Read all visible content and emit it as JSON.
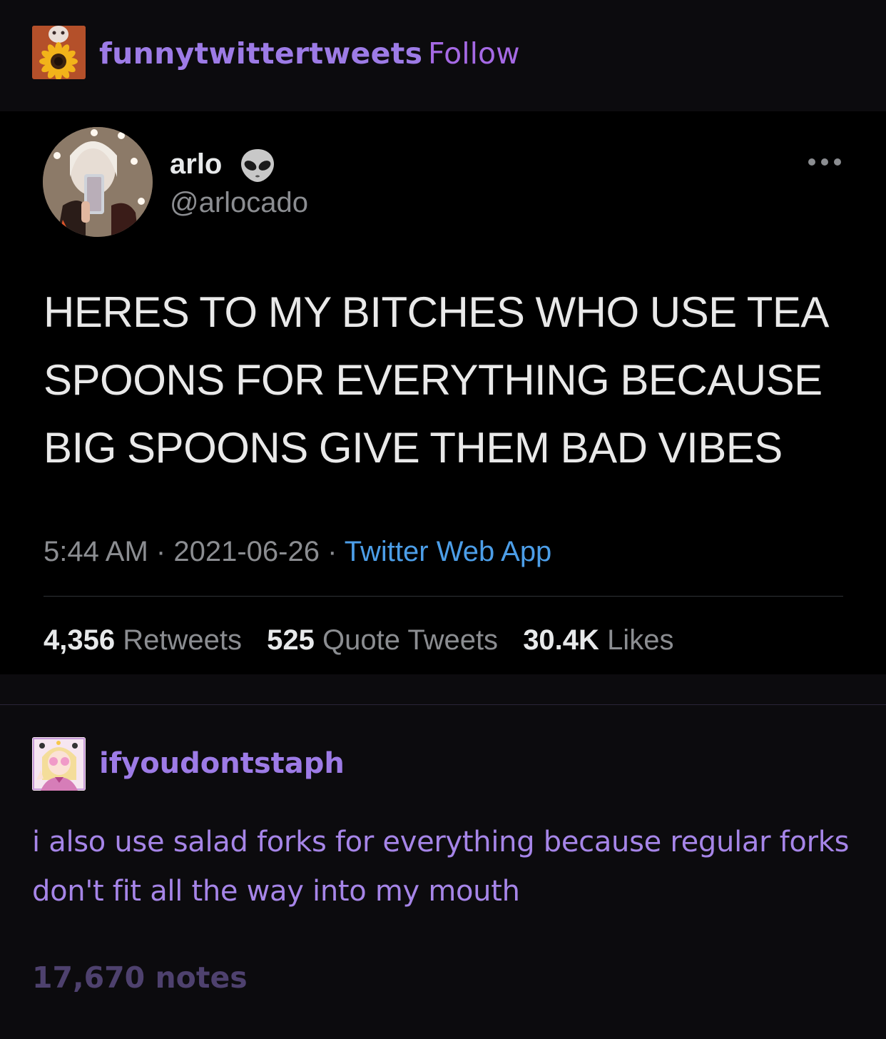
{
  "post": {
    "username": "funnytwittertweets",
    "follow_label": "Follow",
    "avatar_icon": "sunflower-avatar"
  },
  "tweet": {
    "display_name": "arlo",
    "emoji_icon": "alien-emoji",
    "handle": "@arlocado",
    "more_icon": "more-dots-icon",
    "text": "HERES TO MY BITCHES WHO USE TEA SPOONS FOR EVERYTHING BECAUSE BIG SPOONS GIVE THEM BAD VIBES",
    "time": "5:44 AM",
    "sep": "·",
    "date": "2021-06-26",
    "source": "Twitter Web App",
    "stats": {
      "retweets_count": "4,356",
      "retweets_label": "Retweets",
      "quotes_count": "525",
      "quotes_label": "Quote Tweets",
      "likes_count": "30.4K",
      "likes_label": "Likes"
    }
  },
  "reblog": {
    "username": "ifyoudontstaph",
    "avatar_icon": "anime-girl-avatar",
    "text": "i also use salad forks for everything because regular forks don't fit all the way into my mouth",
    "notes": "17,670 notes"
  },
  "colors": {
    "background": "#0c0b0e",
    "tweet_background": "#000000",
    "tumblr_purple": "#9d7be6",
    "follow_purple": "#a569e4",
    "twitter_blue": "#4c9ee8",
    "notes_color": "#4e416e"
  }
}
